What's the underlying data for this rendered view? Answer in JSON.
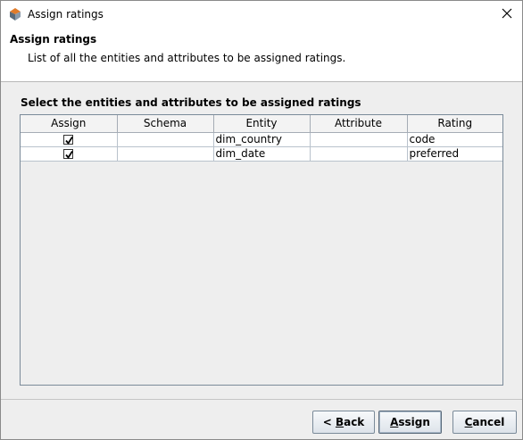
{
  "window": {
    "title": "Assign ratings",
    "close_icon": "close-icon",
    "app_icon": "app-icon"
  },
  "header": {
    "title": "Assign ratings",
    "description": "List of all the entities and attributes to be assigned ratings."
  },
  "section": {
    "title": "Select the entities and attributes to be assigned ratings"
  },
  "table": {
    "columns": [
      "Assign",
      "Schema",
      "Entity",
      "Attribute",
      "Rating"
    ],
    "rows": [
      {
        "assign": true,
        "schema": "",
        "entity": "dim_country",
        "attribute": "",
        "rating": "code"
      },
      {
        "assign": true,
        "schema": "",
        "entity": "dim_date",
        "attribute": "",
        "rating": "preferred"
      }
    ]
  },
  "buttons": {
    "back": {
      "prefix": "< ",
      "mnemonic": "B",
      "rest": "ack"
    },
    "assign": {
      "prefix": "",
      "mnemonic": "A",
      "rest": "ssign"
    },
    "cancel": {
      "prefix": "",
      "mnemonic": "C",
      "rest": "ancel"
    }
  }
}
